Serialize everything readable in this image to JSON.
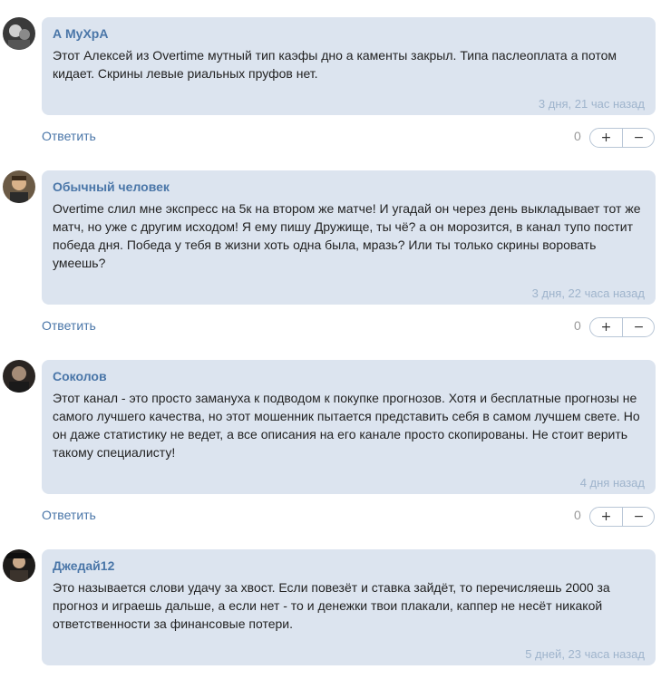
{
  "comments": [
    {
      "author": "А МуХрА",
      "text": "Этот Алексей из Overtime мутный тип каэфы дно а каменты закрыл. Типа паслеоплата а потом кидает. Скрины левые риальных пруфов нет.",
      "time": "3 дня, 21 час назад",
      "reply_label": "Ответить",
      "rating": "0",
      "plus": "+",
      "minus": "−"
    },
    {
      "author": "Обычный человек",
      "text": "Overtime слил мне экспресс на 5к на втором же матче! И угадай он через день выкладывает тот же матч, но уже с другим исходом! Я ему пишу Дружище, ты чё? а он морозится, в канал тупо постит победа дня. Победа у тебя в жизни хоть одна была, мразь? Или ты только скрины воровать умеешь?",
      "time": "3 дня, 22 часа назад",
      "reply_label": "Ответить",
      "rating": "0",
      "plus": "+",
      "minus": "−"
    },
    {
      "author": "Соколов",
      "text": "Этот канал - это просто замануха к подводом к покупке прогнозов. Хотя и бесплатные прогнозы не самого лучшего качества, но этот мошенник пытается представить себя в самом лучшем свете. Но он даже статистику не ведет, а все описания на его канале просто скопированы. Не стоит верить такому специалисту!",
      "time": "4 дня назад",
      "reply_label": "Ответить",
      "rating": "0",
      "plus": "+",
      "minus": "−"
    },
    {
      "author": "Джедай12",
      "text": "Это называется слови удачу за хвост. Если повезёт и ставка зайдёт, то перечисляешь 2000 за прогноз и играешь дальше, а если нет - то и денежки твои плакали, каппер не несёт никакой ответственности за финансовые потери.",
      "time": "5 дней, 23 часа назад"
    }
  ]
}
